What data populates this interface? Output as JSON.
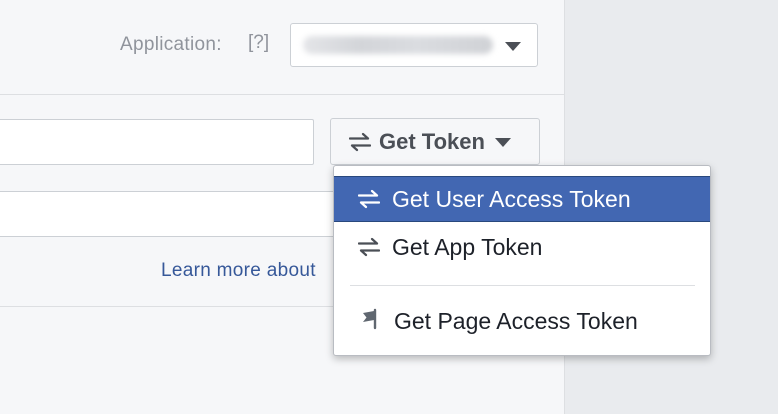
{
  "header": {
    "application_label": "Application:",
    "help_marker": "[?]",
    "application_select": {
      "selected_value": ""
    }
  },
  "token_field": {
    "value": ""
  },
  "get_token_button": {
    "icon": "swap-arrows-icon",
    "label": "Get Token",
    "caret_icon": "caret-down-icon"
  },
  "second_field": {
    "value": ""
  },
  "learn_more_link": "Learn more about",
  "dropdown_menu": {
    "items": [
      {
        "icon": "swap-arrows-icon",
        "label": "Get User Access Token",
        "selected": true
      },
      {
        "icon": "swap-arrows-icon",
        "label": "Get App Token",
        "selected": false
      },
      {
        "icon": "flag-icon",
        "label": "Get Page Access Token",
        "selected": false
      }
    ]
  },
  "colors": {
    "panel_background": "#f6f7f9",
    "outer_background": "#e9ebee",
    "selected_item": "#4267b2",
    "link": "#365899",
    "muted_text": "#90949c",
    "dark_text": "#4b4f56"
  }
}
